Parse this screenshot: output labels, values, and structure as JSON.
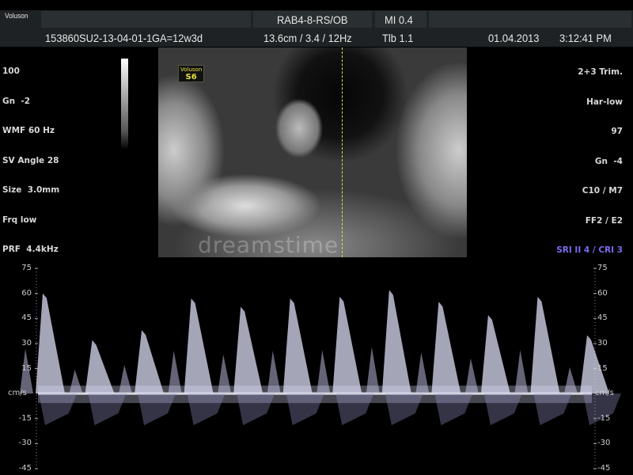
{
  "header": {
    "brand": "Voluson",
    "probe": "RAB4-8-RS/OB",
    "mi": "MI 0.4",
    "patient_id": "153860SU2-13-04-01-1",
    "ga": "GA=12w3d",
    "depth": "13.6cm / 3.4 / 12Hz",
    "tib": "Tlb 1.1",
    "date": "01.04.2013",
    "time": "3:12:41 PM"
  },
  "left_params": [
    "100",
    "Gn  -2",
    "WMF 60 Hz",
    "SV Angle 28",
    "Size  3.0mm",
    "Frq low",
    "PRF  4.4kHz"
  ],
  "right_params": [
    "2+3 Trim.",
    "Har-low",
    "97",
    "Gn  -4",
    "C10 / M7",
    "FF2 / E2"
  ],
  "right_params_highlight": "SRI II 4 / CRI 3",
  "image_label": {
    "brand": "Voluson",
    "code": "S6"
  },
  "watermark": "dreamstime",
  "doppler": {
    "unit": "cm/s",
    "ticks": [
      75,
      60,
      45,
      30,
      15,
      -15,
      -30,
      -45
    ],
    "range": [
      -45,
      75
    ],
    "peak_velocities": [
      60,
      32,
      38,
      57,
      52,
      57,
      58,
      62,
      55,
      47,
      58,
      35
    ],
    "highlight_color": "#7a6cf0",
    "marker_color": "#e0e040"
  }
}
